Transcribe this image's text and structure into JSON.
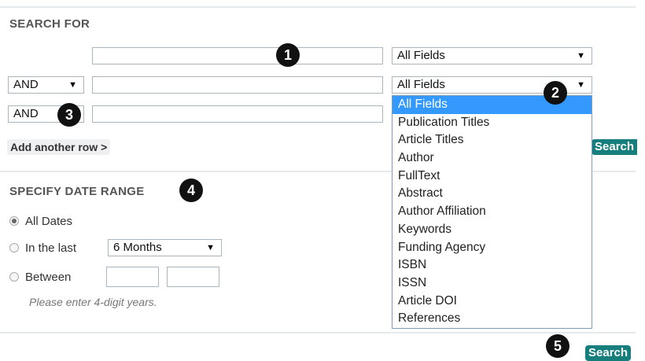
{
  "search_for": {
    "title": "SEARCH FOR",
    "row1": {
      "term": "",
      "field": "All Fields"
    },
    "row2": {
      "operator": "AND",
      "term": "",
      "field": "All Fields"
    },
    "row3": {
      "operator": "AND",
      "term": ""
    },
    "add_row_label": "Add another row >",
    "search_label": "Search"
  },
  "field_dropdown": {
    "selected": "All Fields",
    "options": [
      "All Fields",
      "Publication Titles",
      "Article Titles",
      "Author",
      "FullText",
      "Abstract",
      "Author Affiliation",
      "Keywords",
      "Funding Agency",
      "ISBN",
      "ISSN",
      "Article DOI",
      "References"
    ]
  },
  "date_range": {
    "title": "SPECIFY DATE RANGE",
    "all_dates_label": "All Dates",
    "in_last_label": "In the last",
    "in_last_value": "6 Months",
    "between_label": "Between",
    "from_year": "",
    "to_year": "",
    "hint": "Please enter 4-digit years.",
    "selected_option": "All Dates"
  },
  "footer": {
    "search_label": "Search"
  },
  "callouts": [
    "1",
    "2",
    "3",
    "4",
    "5"
  ],
  "colors": {
    "search_button": "#167e7c",
    "dropdown_highlight": "#3399ff",
    "callout": "#111111"
  }
}
